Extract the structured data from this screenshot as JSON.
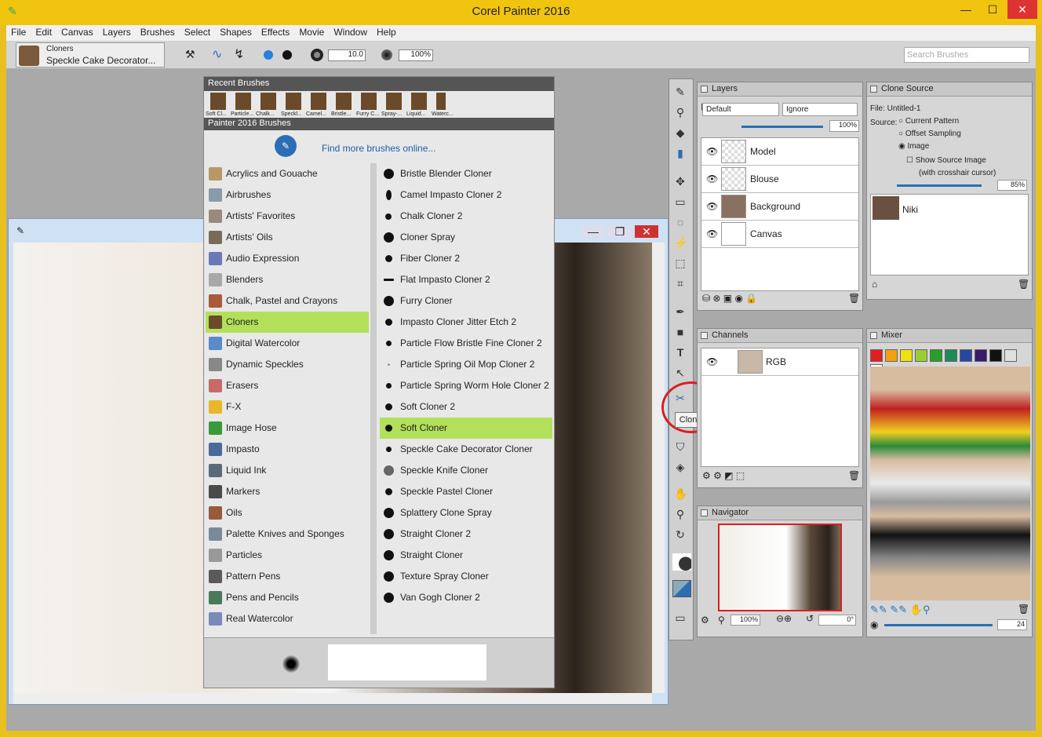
{
  "app": {
    "title": "Corel Painter 2016"
  },
  "menu": [
    "File",
    "Edit",
    "Canvas",
    "Layers",
    "Brushes",
    "Select",
    "Shapes",
    "Effects",
    "Movie",
    "Window",
    "Help"
  ],
  "propbar": {
    "category": "Cloners",
    "variant": "Speckle Cake Decorator...",
    "size": "10.0",
    "opacity": "100%",
    "search_placeholder": "Search Brushes"
  },
  "brush_panel": {
    "recent_title": "Recent Brushes",
    "recent": [
      "Soft Cl...",
      "Particle...",
      "Chalk...",
      "Speckl...",
      "Camel...",
      "Bristle...",
      "Furry C...",
      "Spray-...",
      "Liquid...",
      "Waterc..."
    ],
    "library_title": "Painter 2016 Brushes",
    "find_more": "Find more brushes online...",
    "categories": [
      "Acrylics and Gouache",
      "Airbrushes",
      "Artists' Favorites",
      "Artists' Oils",
      "Audio Expression",
      "Blenders",
      "Chalk, Pastel and Crayons",
      "Cloners",
      "Digital Watercolor",
      "Dynamic Speckles",
      "Erasers",
      "F-X",
      "Image Hose",
      "Impasto",
      "Liquid Ink",
      "Markers",
      "Oils",
      "Palette Knives and Sponges",
      "Particles",
      "Pattern Pens",
      "Pens and Pencils",
      "Real Watercolor"
    ],
    "selected_category": "Cloners",
    "variants": [
      "Bristle Blender Cloner",
      "Camel Impasto Cloner 2",
      "Chalk Cloner 2",
      "Cloner Spray",
      "Fiber Cloner 2",
      "Flat Impasto Cloner 2",
      "Furry Cloner",
      "Impasto Cloner Jitter Etch 2",
      "Particle Flow Bristle Fine Cloner 2",
      "Particle Spring Oil Mop Cloner 2",
      "Particle Spring Worm Hole Cloner 2",
      "Soft Cloner 2",
      "Soft Cloner",
      "Speckle Cake Decorator Cloner",
      "Speckle Knife Cloner",
      "Speckle Pastel Cloner",
      "Splattery Clone Spray",
      "Straight Cloner 2",
      "Straight Cloner",
      "Texture Spray Cloner",
      "Van Gogh Cloner 2"
    ],
    "selected_variant": "Soft Cloner"
  },
  "tooltip": "Cloner",
  "layers": {
    "title": "Layers",
    "composite": "Default",
    "depth": "Ignore",
    "opacity": "100%",
    "items": [
      "Model",
      "Blouse",
      "Background",
      "Canvas"
    ],
    "selected": "Model"
  },
  "clone_source": {
    "title": "Clone Source",
    "file": "File: Untitled-1",
    "source_label": "Source:",
    "opt1": "Current Pattern",
    "opt2": "Offset Sampling",
    "opt3": "Image",
    "show": "Show Source Image",
    "crosshair": "(with crosshair cursor)",
    "opacity": "85%",
    "item": "Niki"
  },
  "channels": {
    "title": "Channels",
    "item": "RGB"
  },
  "navigator": {
    "title": "Navigator",
    "zoom": "100%",
    "angle": "0°"
  },
  "mixer": {
    "title": "Mixer",
    "size": "24",
    "colors": [
      "#e02020",
      "#f0a010",
      "#f0e010",
      "#9acd32",
      "#2a9d2a",
      "#1e8a5a",
      "#2848a0",
      "#3a1a6a",
      "#111111",
      "#e0e0e0",
      "#ffffff"
    ]
  }
}
